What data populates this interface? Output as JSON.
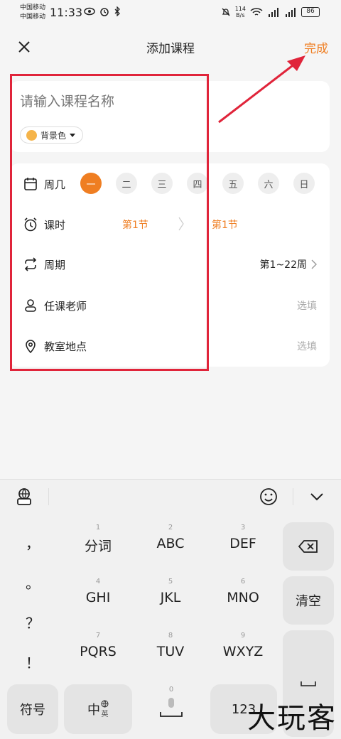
{
  "status_bar": {
    "carrier1": "中国移动",
    "carrier2": "中国移动",
    "time": "11:33",
    "net_speed_value": "114",
    "net_speed_unit": "B/s",
    "battery": "86"
  },
  "header": {
    "title": "添加课程",
    "done_label": "完成"
  },
  "course": {
    "name_placeholder": "请输入课程名称",
    "bg_color_label": "背景色",
    "bg_color": "#f5b44a"
  },
  "weekday": {
    "label": "周几",
    "days": [
      "一",
      "二",
      "三",
      "四",
      "五",
      "六",
      "日"
    ],
    "selected": "一"
  },
  "lesson": {
    "label": "课时",
    "start": "第1节",
    "end": "第1节"
  },
  "period": {
    "label": "周期",
    "value": "第1~22周"
  },
  "teacher": {
    "label": "任课老师",
    "hint": "选填"
  },
  "classroom": {
    "label": "教室地点",
    "hint": "选填"
  },
  "keyboard": {
    "punctuation": [
      "，",
      "。",
      "？",
      "！"
    ],
    "keys": [
      {
        "num": "1",
        "label": "分词"
      },
      {
        "num": "2",
        "label": "ABC"
      },
      {
        "num": "3",
        "label": "DEF"
      },
      {
        "num": "4",
        "label": "GHI"
      },
      {
        "num": "5",
        "label": "JKL"
      },
      {
        "num": "6",
        "label": "MNO"
      },
      {
        "num": "7",
        "label": "PQRS"
      },
      {
        "num": "8",
        "label": "TUV"
      },
      {
        "num": "9",
        "label": "WXYZ"
      }
    ],
    "clear_label": "清空",
    "symbol_label": "符号",
    "lang_main": "中",
    "lang_sub": "英",
    "zero_num": "0",
    "num_label": "123"
  },
  "watermark": "大玩客",
  "colors": {
    "accent": "#ef7e22",
    "annotation": "#e0243a"
  }
}
